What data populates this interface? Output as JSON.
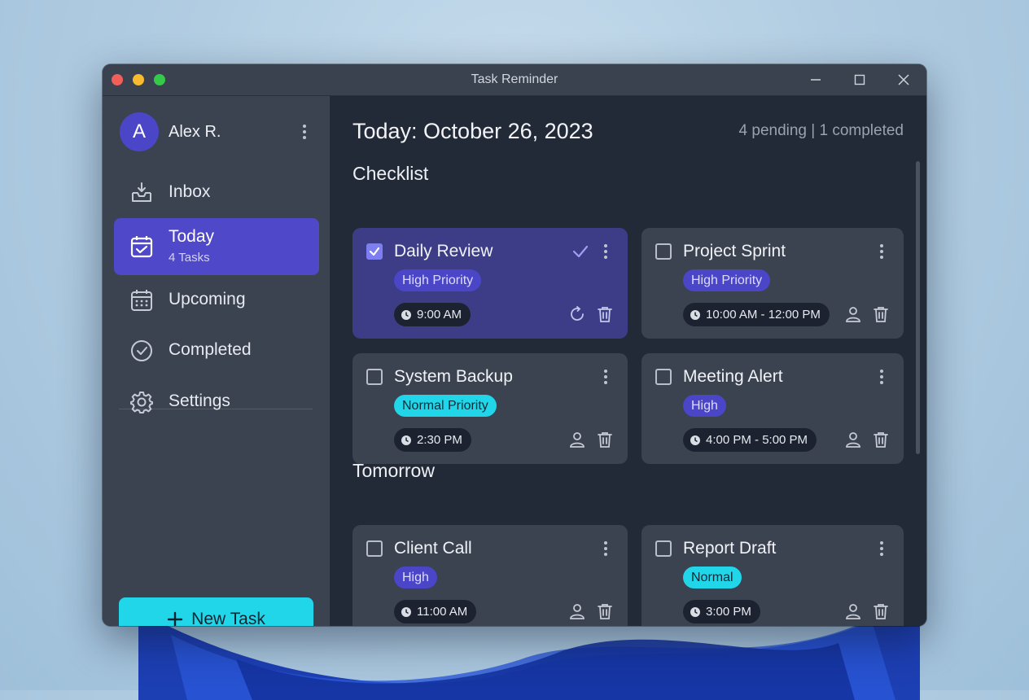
{
  "window": {
    "title": "Task Reminder"
  },
  "sidebar": {
    "avatar_letter": "A",
    "user_name": "Alex R.",
    "items": [
      {
        "label": "Inbox",
        "icon": "inbox-icon"
      },
      {
        "label": "Today",
        "sub": "4 Tasks",
        "icon": "calendar-check-icon",
        "active": true
      },
      {
        "label": "Upcoming",
        "icon": "calendar-icon"
      },
      {
        "label": "Completed",
        "icon": "check-circle-icon"
      },
      {
        "label": "Settings",
        "icon": "gear-icon"
      }
    ],
    "new_task_label": "New Task"
  },
  "main": {
    "title": "Today: October 26, 2023",
    "stats": "4 pending | 1 completed",
    "sections": [
      {
        "title": "Checklist",
        "cards": [
          {
            "title": "Daily Review",
            "badge": "High Priority",
            "time": "9:00 AM",
            "checked": true
          },
          {
            "title": "Project Sprint",
            "badge": "High Priority",
            "time": "10:00 AM - 12:00 PM",
            "checked": false
          },
          {
            "title": "System Backup",
            "badge": "Normal Priority",
            "time": "2:30 PM",
            "checked": false
          },
          {
            "title": "Meeting Alert",
            "badge": "High",
            "time": "4:00 PM - 5:00 PM",
            "checked": false
          }
        ]
      },
      {
        "title": "Tomorrow",
        "cards": [
          {
            "title": "Client Call",
            "badge": "High",
            "time": "11:00 AM",
            "checked": false
          },
          {
            "title": "Report Draft",
            "badge": "Normal",
            "time": "3:00 PM",
            "checked": false
          }
        ]
      }
    ]
  },
  "colors": {
    "accent": "#4f48c9",
    "cyan": "#22d6ea",
    "sidebar_bg": "#3b4351",
    "main_bg": "#222a38",
    "completed_card": "#3c3d86"
  }
}
